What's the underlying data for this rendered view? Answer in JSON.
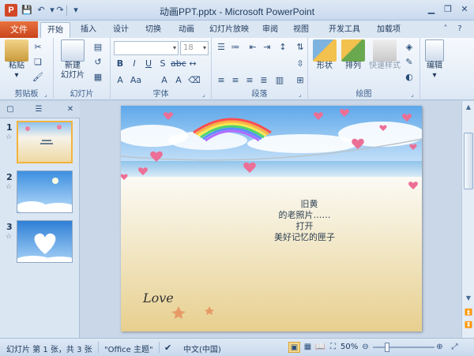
{
  "titlebar": {
    "title": "动画PPT.pptx - Microsoft PowerPoint",
    "app_icon": "P"
  },
  "tabs": {
    "file": "文件",
    "items": [
      "开始",
      "插入",
      "设计",
      "切换",
      "动画",
      "幻灯片放映",
      "审阅",
      "视图",
      "开发工具",
      "加载项"
    ],
    "active": "开始"
  },
  "ribbon": {
    "clipboard": {
      "label": "剪贴板",
      "paste": "粘贴"
    },
    "slides": {
      "label": "幻灯片",
      "new_slide_line1": "新建",
      "new_slide_line2": "幻灯片"
    },
    "font": {
      "label": "字体",
      "font_size": "18"
    },
    "paragraph": {
      "label": "段落"
    },
    "drawing": {
      "label": "绘图",
      "shape": "形状",
      "arrange": "排列",
      "quick_styles": "快速样式"
    },
    "editing": {
      "label": "编辑"
    }
  },
  "slide_text": {
    "line1": "旧黄",
    "line2": "的老照片……",
    "line3": "打开",
    "line4": "美好记忆的匣子",
    "love": "Love"
  },
  "thumbnails": [
    {
      "number": "1",
      "star": "☆",
      "selected": true
    },
    {
      "number": "2",
      "star": "☆",
      "selected": false
    },
    {
      "number": "3",
      "star": "☆",
      "selected": false
    }
  ],
  "statusbar": {
    "slide_info": "幻灯片 第 1 张，共 3 张",
    "theme": "\"Office 主题\"",
    "language": "中文(中国)",
    "zoom": "50%"
  },
  "colors": {
    "file_tab": "#d24726",
    "selected_thumb_border": "#f3b33d",
    "sky": "#9cc9f0",
    "sand": "#ecd79a"
  }
}
